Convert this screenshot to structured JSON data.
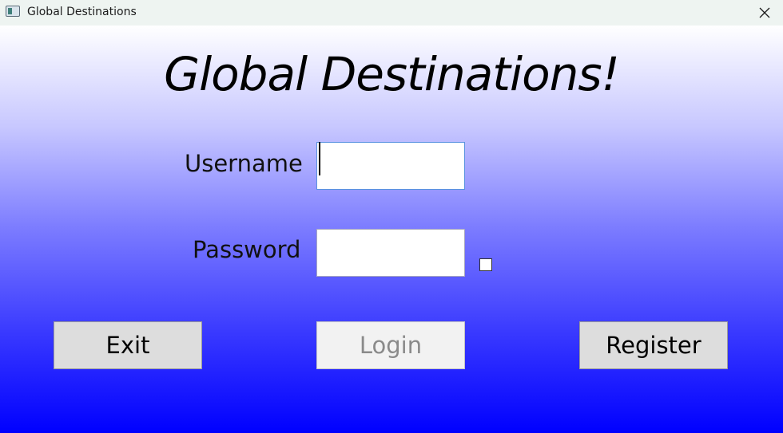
{
  "window": {
    "title": "Global Destinations"
  },
  "form": {
    "heading": "Global Destinations!",
    "username_label": "Username",
    "username_value": "",
    "password_label": "Password",
    "password_value": "",
    "show_password_checked": false
  },
  "buttons": {
    "exit": "Exit",
    "login": "Login",
    "register": "Register"
  },
  "colors": {
    "gradient_top": "#ffffff",
    "gradient_bottom": "#0000ff",
    "focus_border": "#5a93e0"
  },
  "icons": {
    "app": "window-app-icon",
    "close": "close-icon"
  }
}
